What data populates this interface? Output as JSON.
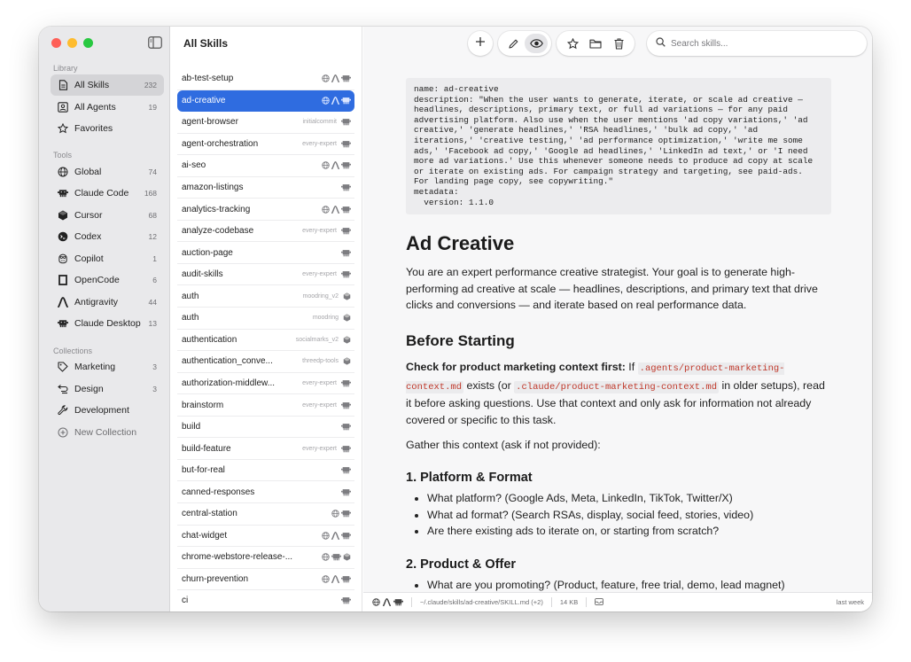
{
  "sidebar": {
    "sections": {
      "library": "Library",
      "tools": "Tools",
      "collections": "Collections"
    },
    "library": [
      {
        "label": "All Skills",
        "count": "232",
        "icon": "document-icon",
        "active": true
      },
      {
        "label": "All Agents",
        "count": "19",
        "icon": "agent-icon"
      },
      {
        "label": "Favorites",
        "count": "",
        "icon": "star-icon"
      }
    ],
    "tools": [
      {
        "label": "Global",
        "count": "74",
        "icon": "globe-icon"
      },
      {
        "label": "Claude Code",
        "count": "168",
        "icon": "claude-code-icon"
      },
      {
        "label": "Cursor",
        "count": "68",
        "icon": "cursor-icon"
      },
      {
        "label": "Codex",
        "count": "12",
        "icon": "codex-icon"
      },
      {
        "label": "Copilot",
        "count": "1",
        "icon": "copilot-icon"
      },
      {
        "label": "OpenCode",
        "count": "6",
        "icon": "opencode-icon"
      },
      {
        "label": "Antigravity",
        "count": "44",
        "icon": "antigravity-icon"
      },
      {
        "label": "Claude Desktop",
        "count": "13",
        "icon": "claude-desktop-icon"
      }
    ],
    "collections": [
      {
        "label": "Marketing",
        "count": "3",
        "icon": "tag-icon"
      },
      {
        "label": "Design",
        "count": "3",
        "icon": "design-icon"
      },
      {
        "label": "Development",
        "count": "",
        "icon": "wrench-icon"
      },
      {
        "label": "New Collection",
        "count": "",
        "icon": "plus-circle-icon"
      }
    ]
  },
  "list": {
    "title": "All Skills",
    "rows": [
      {
        "name": "ab-test-setup",
        "source": "",
        "icons": [
          "globe",
          "antigravity",
          "claude"
        ]
      },
      {
        "name": "ad-creative",
        "source": "",
        "icons": [
          "globe",
          "antigravity",
          "claude"
        ],
        "selected": true
      },
      {
        "name": "agent-browser",
        "source": "initialcommit",
        "icons": [
          "claude"
        ]
      },
      {
        "name": "agent-orchestration",
        "source": "every-expert",
        "icons": [
          "claude"
        ]
      },
      {
        "name": "ai-seo",
        "source": "",
        "icons": [
          "globe",
          "antigravity",
          "claude"
        ]
      },
      {
        "name": "amazon-listings",
        "source": "",
        "icons": [
          "claude"
        ]
      },
      {
        "name": "analytics-tracking",
        "source": "",
        "icons": [
          "globe",
          "antigravity",
          "claude"
        ]
      },
      {
        "name": "analyze-codebase",
        "source": "every-expert",
        "icons": [
          "claude"
        ]
      },
      {
        "name": "auction-page",
        "source": "",
        "icons": [
          "claude"
        ]
      },
      {
        "name": "audit-skills",
        "source": "every-expert",
        "icons": [
          "claude"
        ]
      },
      {
        "name": "auth",
        "source": "moodring_v2",
        "icons": [
          "cursor"
        ]
      },
      {
        "name": "auth",
        "source": "moodring",
        "icons": [
          "cursor"
        ]
      },
      {
        "name": "authentication",
        "source": "socialmarks_v2",
        "icons": [
          "cursor"
        ]
      },
      {
        "name": "authentication_conve...",
        "source": "threedp-tools",
        "icons": [
          "cursor"
        ]
      },
      {
        "name": "authorization-middlew...",
        "source": "every-expert",
        "icons": [
          "claude"
        ]
      },
      {
        "name": "brainstorm",
        "source": "every-expert",
        "icons": [
          "claude"
        ]
      },
      {
        "name": "build",
        "source": "",
        "icons": [
          "claude"
        ]
      },
      {
        "name": "build-feature",
        "source": "every-expert",
        "icons": [
          "claude"
        ]
      },
      {
        "name": "but-for-real",
        "source": "",
        "icons": [
          "claude"
        ]
      },
      {
        "name": "canned-responses",
        "source": "",
        "icons": [
          "claude"
        ]
      },
      {
        "name": "central-station",
        "source": "",
        "icons": [
          "globe",
          "claude"
        ]
      },
      {
        "name": "chat-widget",
        "source": "",
        "icons": [
          "globe",
          "antigravity",
          "claude"
        ]
      },
      {
        "name": "chrome-webstore-release-...",
        "source": "",
        "icons": [
          "globe",
          "claude",
          "cursor"
        ]
      },
      {
        "name": "churn-prevention",
        "source": "",
        "icons": [
          "globe",
          "antigravity",
          "claude"
        ]
      },
      {
        "name": "ci",
        "source": "",
        "icons": [
          "claude"
        ]
      }
    ]
  },
  "toolbar": {
    "search_placeholder": "Search skills...",
    "buttons": [
      "plus-icon",
      "pencil-icon",
      "eye-icon",
      "star-icon",
      "folder-icon",
      "trash-icon"
    ]
  },
  "document": {
    "frontmatter": "name: ad-creative\ndescription: \"When the user wants to generate, iterate, or scale ad creative —\nheadlines, descriptions, primary text, or full ad variations — for any paid\nadvertising platform. Also use when the user mentions 'ad copy variations,' 'ad\ncreative,' 'generate headlines,' 'RSA headlines,' 'bulk ad copy,' 'ad\niterations,' 'creative testing,' 'ad performance optimization,' 'write me some\nads,' 'Facebook ad copy,' 'Google ad headlines,' 'LinkedIn ad text,' or 'I need\nmore ad variations.' Use this whenever someone needs to produce ad copy at scale\nor iterate on existing ads. For campaign strategy and targeting, see paid-ads.\nFor landing page copy, see copywriting.\"\nmetadata:\n  version: 1.1.0",
    "title": "Ad Creative",
    "intro": "You are an expert performance creative strategist. Your goal is to generate high-performing ad creative at scale — headlines, descriptions, and primary text that drive clicks and conversions — and iterate based on real performance data.",
    "before_heading": "Before Starting",
    "check_bold": "Check for product marketing context first:",
    "check_if": " If ",
    "check_code1": ".agents/product-marketing-context.md",
    "check_mid": " exists (or ",
    "check_code2": ".claude/product-marketing-context.md",
    "check_end": " in older setups), read it before asking questions. Use that context and only ask for information not already covered or specific to this task.",
    "gather": "Gather this context (ask if not provided):",
    "h_platform": "1. Platform & Format",
    "platform_items": [
      "What platform? (Google Ads, Meta, LinkedIn, TikTok, Twitter/X)",
      "What ad format? (Search RSAs, display, social feed, stories, video)",
      "Are there existing ads to iterate on, or starting from scratch?"
    ],
    "h_product": "2. Product & Offer",
    "product_items": [
      "What are you promoting? (Product, feature, free trial, demo, lead magnet)"
    ]
  },
  "statusbar": {
    "path": "~/.claude/skills/ad-creative/SKILL.md (+2)",
    "size": "14 KB",
    "modified": "last week"
  },
  "colors": {
    "accent": "#2f6ce0",
    "code": "#c0392b",
    "sidebar_bg": "#e9e9eb"
  }
}
